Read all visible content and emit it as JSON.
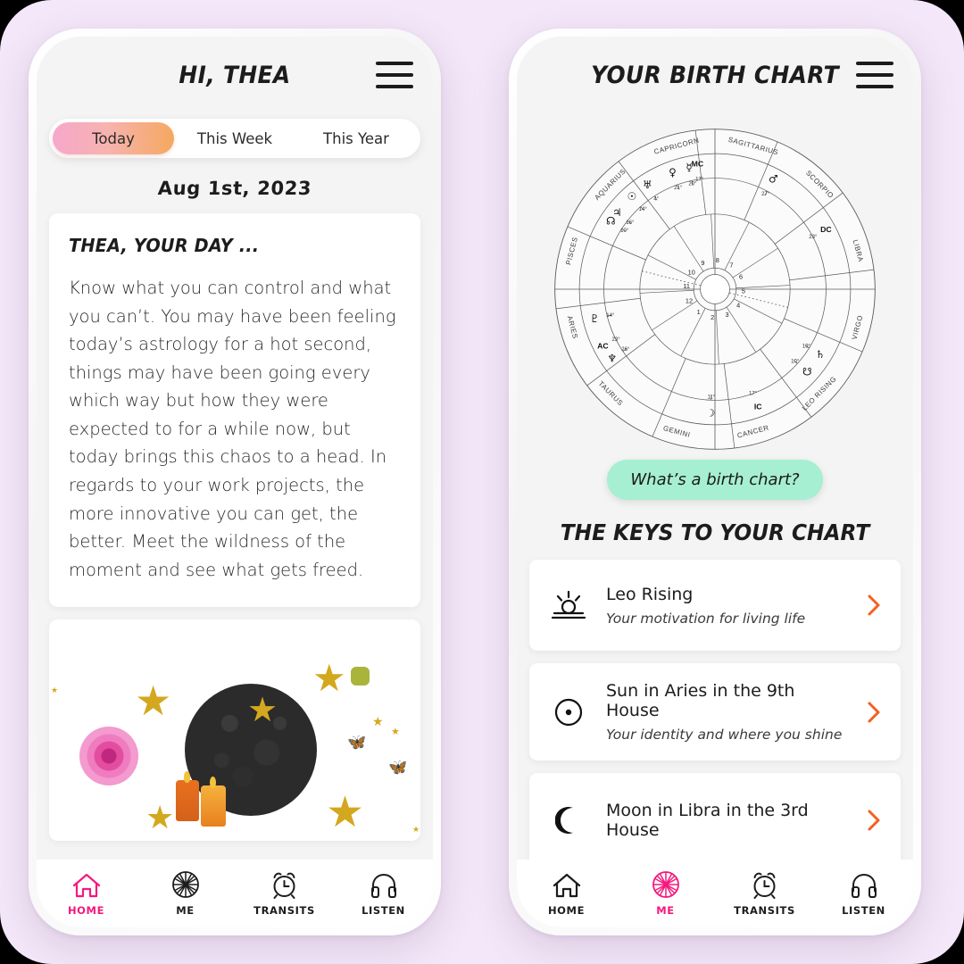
{
  "theme": {
    "page_background": "#F4E7F9",
    "accent_pink": "#F5187E",
    "accent_orange": "#F4601E",
    "mint": "#A6EFD2",
    "tab_gradient_from": "#F6A7CB",
    "tab_gradient_to": "#F5A85F",
    "card_white": "#FFFFFF",
    "screen_grey": "#F4F4F4"
  },
  "phone_home": {
    "header": {
      "title": "HI, THEA",
      "menu_icon": "hamburger-menu-icon"
    },
    "tabs": [
      {
        "label": "Today",
        "active": true
      },
      {
        "label": "This Week",
        "active": false
      },
      {
        "label": "This Year",
        "active": false
      }
    ],
    "date": "Aug 1st, 2023",
    "horoscope": {
      "heading": "THEA, YOUR DAY ...",
      "body": "Know what you can control and what you can’t. You may have been feeling today’s astrology for a hot second, things may have been going every which way but how they were expected to for a while now, but today brings this chaos to a head. In regards to your work projects, the more innovative you can get, the better. Meet the wildness of the moment and see what gets freed."
    },
    "collage": {
      "alt": "moon-collage",
      "elements": [
        "new-moon",
        "pink-rose",
        "lit-candles",
        "gold-stars",
        "butterflies",
        "green-chip"
      ]
    },
    "nav": [
      {
        "label": "HOME",
        "icon": "house-icon",
        "active": true
      },
      {
        "label": "ME",
        "icon": "wheel-icon",
        "active": false
      },
      {
        "label": "TRANSITS",
        "icon": "alarm-clock-icon",
        "active": false
      },
      {
        "label": "LISTEN",
        "icon": "headphones-icon",
        "active": false
      }
    ]
  },
  "phone_chart": {
    "header": {
      "title": "YOUR BIRTH CHART",
      "menu_icon": "hamburger-menu-icon"
    },
    "pill_label": "What’s a birth chart?",
    "keys_heading": "THE KEYS TO YOUR CHART",
    "keys": [
      {
        "icon": "sunrise-icon",
        "title": "Leo Rising",
        "subtitle": "Your motivation for living life",
        "chevron": "chevron-right-icon"
      },
      {
        "icon": "sun-icon",
        "title": "Sun in Aries in the 9th House",
        "subtitle": "Your identity and where you shine",
        "chevron": "chevron-right-icon"
      },
      {
        "icon": "moon-icon",
        "title": "Moon in Libra in the 3rd House",
        "subtitle": "",
        "chevron": "chevron-right-icon"
      }
    ],
    "nav": [
      {
        "label": "HOME",
        "icon": "house-icon",
        "active": false
      },
      {
        "label": "ME",
        "icon": "wheel-icon",
        "active": true
      },
      {
        "label": "TRANSITS",
        "icon": "alarm-clock-icon",
        "active": false
      },
      {
        "label": "LISTEN",
        "icon": "headphones-icon",
        "active": false
      }
    ]
  },
  "chart_data": {
    "type": "natal-wheel",
    "title": "Your Birth Chart",
    "zodiac_signs": [
      "ARIES",
      "PISCES",
      "AQUARIUS",
      "CAPRICORN",
      "SAGITTARIUS",
      "SCORPIO",
      "LIBRA",
      "VIRGO",
      "LEO RISING",
      "CANCER",
      "GEMINI",
      "TAURUS"
    ],
    "house_numbers": [
      1,
      2,
      3,
      4,
      5,
      6,
      7,
      8,
      9,
      10,
      11,
      12
    ],
    "angles": [
      {
        "name": "MC",
        "label": "MC",
        "sign": "Taurus",
        "degree": "17°"
      },
      {
        "name": "DC",
        "label": "DC",
        "sign": "Aquarius",
        "degree": "23°"
      },
      {
        "name": "IC",
        "label": "IC",
        "sign": "Scorpio",
        "degree": "17°"
      },
      {
        "name": "AC",
        "label": "AC",
        "sign": "Leo",
        "degree": "23°"
      }
    ],
    "placements": [
      {
        "body": "Jupiter",
        "glyph": "♃",
        "sign": "Aries",
        "degree": "16°"
      },
      {
        "body": "Sun",
        "glyph": "☉",
        "sign": "Aries",
        "degree": "14°"
      },
      {
        "body": "Uranus",
        "glyph": "♅",
        "sign": "Aries",
        "degree": "4°"
      },
      {
        "body": "Venus",
        "glyph": "♀",
        "sign": "Aries",
        "degree": "21°"
      },
      {
        "body": "Mercury",
        "glyph": "☿",
        "sign": "Aries",
        "degree": "20°"
      },
      {
        "body": "Mars",
        "glyph": "♂",
        "sign": "Aquarius",
        "degree": "27°"
      },
      {
        "body": "Saturn",
        "glyph": "♄",
        "sign": "Sagittarius",
        "degree": "19°"
      },
      {
        "body": "South Node",
        "glyph": "☋",
        "sign": "Sagittarius",
        "degree": "10°"
      },
      {
        "body": "Moon",
        "glyph": "☽",
        "sign": "Libra",
        "degree": "11°"
      },
      {
        "body": "Neptune",
        "glyph": "♆",
        "sign": "Leo",
        "degree": "26°"
      },
      {
        "body": "Pluto",
        "glyph": "♇",
        "sign": "Cancer",
        "degree": "14°"
      },
      {
        "body": "North Node",
        "glyph": "☊",
        "sign": "Gemini",
        "degree": "10°"
      }
    ],
    "grid": true,
    "legend": "none"
  }
}
